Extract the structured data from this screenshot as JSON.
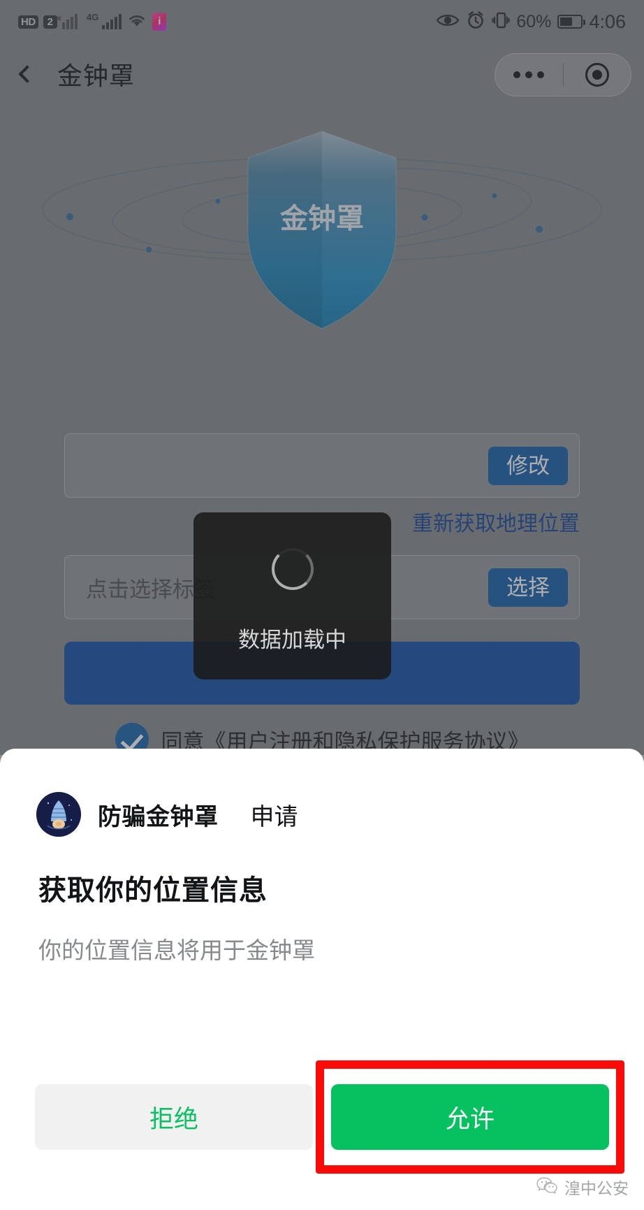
{
  "status_bar": {
    "hd_badge": "HD",
    "sim_badge": "2",
    "network_label": "4G",
    "battery_percent": "60%",
    "time": "4:06",
    "icons": [
      "hd-badge",
      "sim-2-badge",
      "signal-bars-inactive",
      "signal-bars-4g",
      "wifi-icon",
      "sim-card-icon",
      "eye-icon",
      "alarm-icon",
      "vibrate-icon",
      "battery-icon"
    ]
  },
  "nav_bar": {
    "title": "金钟罩",
    "back_icon": "chevron-left-icon",
    "capsule": {
      "more_icon": "more-dots-icon",
      "target_icon": "target-icon"
    }
  },
  "hero": {
    "shield_label": "金钟罩"
  },
  "form": {
    "location_value": "",
    "location_placeholder": "",
    "modify_label": "修改",
    "relocate_link": "重新获取地理位置",
    "tag_placeholder": "点击选择标签",
    "select_label": "选择",
    "submit_label": "",
    "agree_text": "同意《用户注册和隐私保护服务协议》",
    "agree_checked": true
  },
  "toast": {
    "text": "数据加载中",
    "spinner_icon": "loading-spinner-icon"
  },
  "dialog": {
    "app_icon": "fangpian-jinzhongzhao-app-icon",
    "app_name": "防骗金钟罩",
    "action": "申请",
    "title": "获取你的位置信息",
    "description": "你的位置信息将用于金钟罩",
    "refuse_label": "拒绝",
    "allow_label": "允许"
  },
  "watermark": {
    "icon": "wechat-icon",
    "text": "湟中公安"
  },
  "colors": {
    "accent_blue": "#1861ad",
    "link_blue": "#17479e",
    "wechat_green": "#07c160",
    "highlight_red": "#fb0b08",
    "page_bg": "#8a8d90"
  }
}
